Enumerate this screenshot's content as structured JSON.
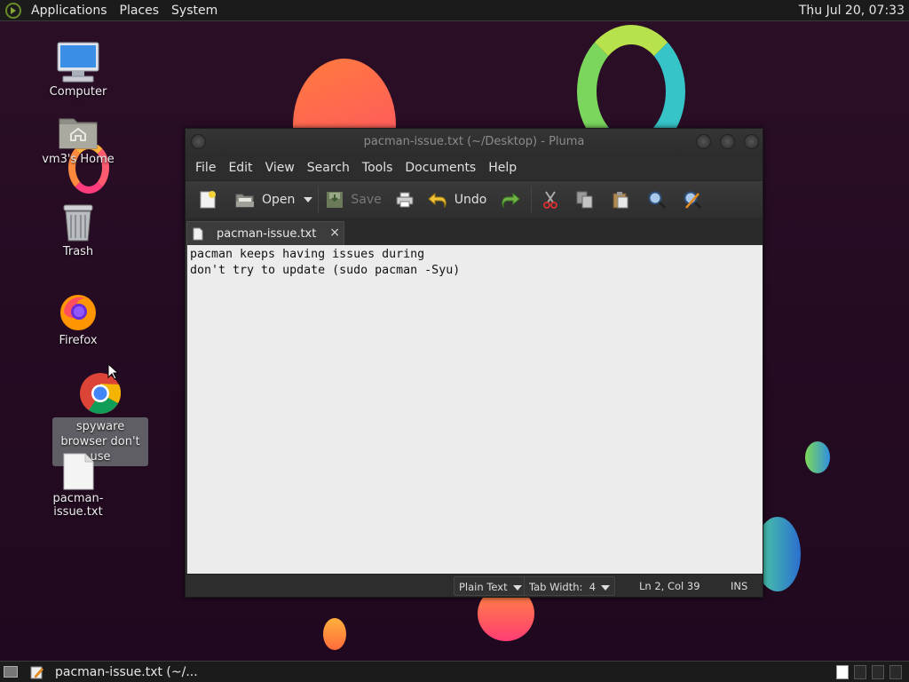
{
  "top_panel": {
    "menus": [
      "Applications",
      "Places",
      "System"
    ],
    "clock": "Thu Jul 20, 07:33"
  },
  "desktop_icons": [
    {
      "label": "Computer",
      "icon": "computer-icon"
    },
    {
      "label": "vm3's Home",
      "icon": "home-folder-icon"
    },
    {
      "label": "Trash",
      "icon": "trash-icon"
    },
    {
      "label": "Firefox",
      "icon": "firefox-icon"
    },
    {
      "label": "spyware browser don't use",
      "icon": "chrome-icon"
    },
    {
      "label": "pacman-issue.txt",
      "icon": "text-file-icon"
    }
  ],
  "window": {
    "title": "pacman-issue.txt (~/Desktop) - Pluma",
    "menus": [
      "File",
      "Edit",
      "View",
      "Search",
      "Tools",
      "Documents",
      "Help"
    ],
    "toolbar": {
      "open": "Open",
      "save": "Save",
      "undo": "Undo"
    },
    "tab": {
      "label": "pacman-issue.txt",
      "close": "×"
    },
    "content": "pacman keeps having issues during\ndon't try to update (sudo pacman -Syu)",
    "status": {
      "language": "Plain Text",
      "tab_width": "Tab Width:  4",
      "position": "Ln 2, Col 39",
      "mode": "INS"
    }
  },
  "taskbar": {
    "task_label": "pacman-issue.txt (~/..."
  },
  "colors": {
    "panel": "#1b1b1b",
    "window_bg": "#3b3b3b",
    "editor_bg": "#ececec"
  }
}
